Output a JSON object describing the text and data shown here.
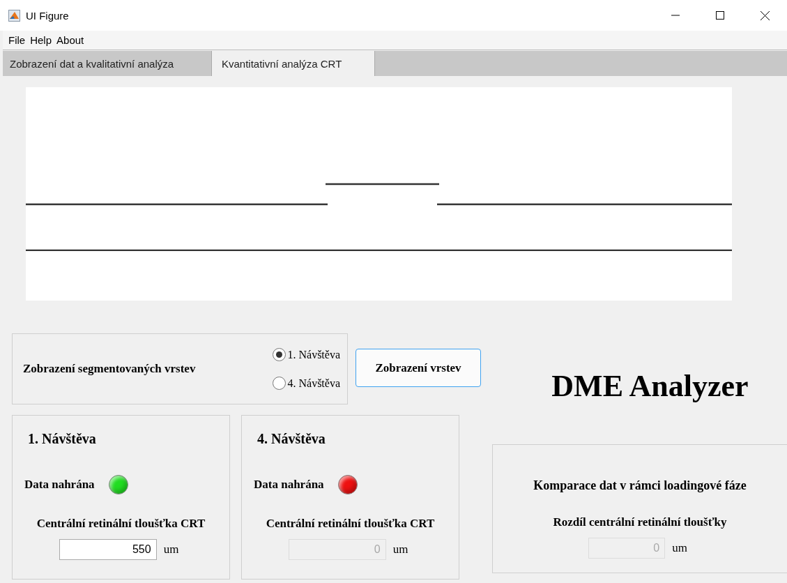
{
  "window": {
    "title": "UI Figure"
  },
  "menu": [
    {
      "label": "File"
    },
    {
      "label": "Help"
    },
    {
      "label": "About"
    }
  ],
  "tabs": [
    {
      "label": "Zobrazení dat a kvalitativní analýza",
      "selected": false
    },
    {
      "label": "Kvantitativní analýza CRT",
      "selected": true
    }
  ],
  "segment_panel": {
    "label": "Zobrazení segmentovaných vrstev",
    "options": [
      {
        "label": "1. Návštěva",
        "selected": true
      },
      {
        "label": "4. Návštěva",
        "selected": false
      }
    ],
    "button": "Zobrazení vrstev"
  },
  "app_title": "DME Analyzer",
  "visits": [
    {
      "title": "1. Návštěva",
      "status_label": "Data nahrána",
      "loaded": true,
      "field_label": "Centrální retinální tloušťka CRT",
      "value": "550",
      "unit": "um",
      "disabled": false
    },
    {
      "title": "4. Návštěva",
      "status_label": "Data nahrána",
      "loaded": false,
      "field_label": "Centrální retinální tloušťka CRT",
      "value": "0",
      "unit": "um",
      "disabled": true
    }
  ],
  "comparison": {
    "title": "Komparace dat v rámci loadingové fáze",
    "field_label": "Rozdíl centrální retinální tloušťky",
    "value": "0",
    "unit": "um",
    "disabled": true
  }
}
